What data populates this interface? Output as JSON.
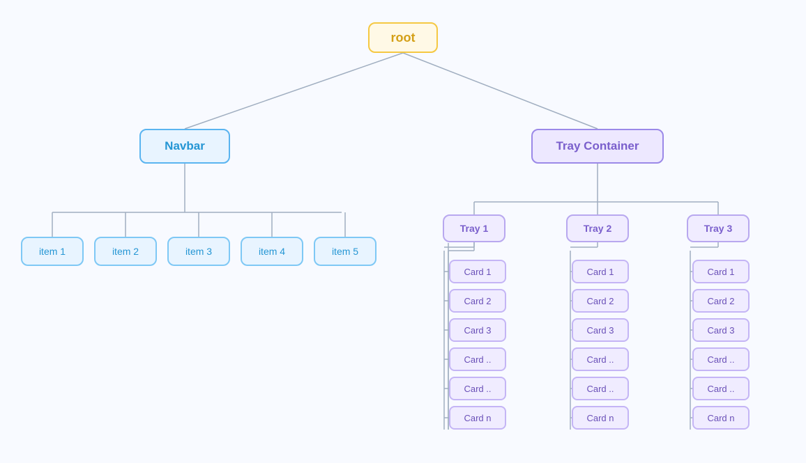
{
  "nodes": {
    "root": "root",
    "navbar": "Navbar",
    "tray_container": "Tray Container",
    "nav_items": [
      "item 1",
      "item 2",
      "item 3",
      "item 4",
      "item 5"
    ],
    "trays": [
      "Tray 1",
      "Tray 2",
      "Tray 3"
    ],
    "cards": [
      "Card 1",
      "Card 2",
      "Card 3",
      "Card ..",
      "Card ..",
      "Card n"
    ]
  }
}
